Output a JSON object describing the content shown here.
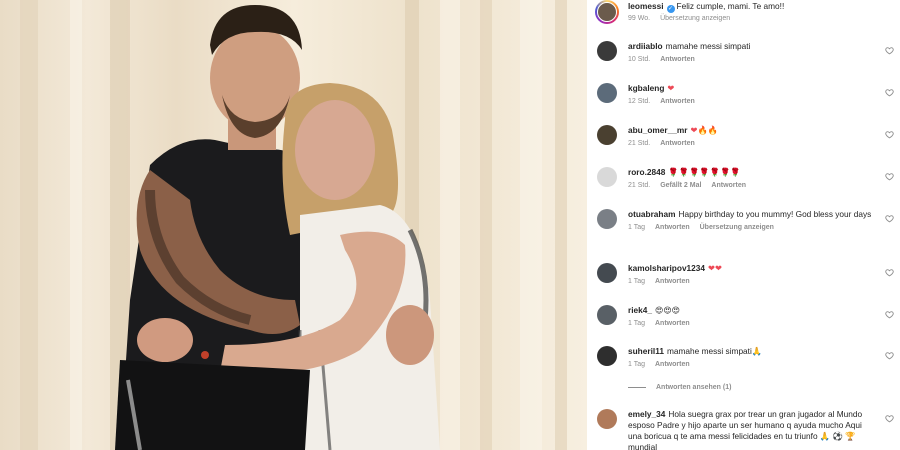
{
  "photo": {
    "alt_subject": ""
  },
  "caption": {
    "username": "leomessi",
    "verified": true,
    "text": "Feliz cumple, mami. Te amo!!",
    "time": "99 Wo.",
    "translate": "Übersetzung anzeigen"
  },
  "comments": [
    {
      "username": "ardiiablo",
      "text": "mamahe messi simpati",
      "time": "10 Std.",
      "reply": "Antworten",
      "avatar_color": "#3a3a3a"
    },
    {
      "username": "kgbaleng",
      "text": "❤",
      "time": "12 Std.",
      "reply": "Antworten",
      "avatar_color": "#5c6b7a"
    },
    {
      "username": "abu_omer__mr",
      "text": "❤🔥🔥",
      "time": "21 Std.",
      "reply": "Antworten",
      "avatar_color": "#4a4030"
    },
    {
      "username": "roro.2848",
      "text": "🌹🌹🌹🌹🌹🌹🌹",
      "time": "21 Std.",
      "likes": "Gefällt 2 Mal",
      "reply": "Antworten",
      "avatar_color": "#d9d9d9"
    },
    {
      "username": "otuabraham",
      "text": "Happy birthday to you mummy! God bless your days",
      "time": "1 Tag",
      "reply": "Antworten",
      "translate": "Übersetzung anzeigen",
      "avatar_color": "#7a7f86"
    },
    {
      "username": "kamolsharipov1234",
      "text": "❤❤",
      "time": "1 Tag",
      "reply": "Antworten",
      "avatar_color": "#444a50"
    },
    {
      "username": "riek4_",
      "text": "😍😍😍",
      "time": "1 Tag",
      "reply": "Antworten",
      "avatar_color": "#596066"
    },
    {
      "username": "suheril11",
      "text": "mamahe messi simpati🙏",
      "time": "1 Tag",
      "reply": "Antworten",
      "avatar_color": "#2e2e2e"
    },
    {
      "username": "emely_34",
      "text": "Hola suegra grax por trear un gran jugador al Mundo esposo Padre y hijo aparte un ser humano q ayuda mucho Aqui una boricua q te ama messi felicidades en tu triunfo 🙏 ⚽ 🏆 mundial",
      "avatar_color": "#b07a5a"
    }
  ],
  "view_replies": "Antworten ansehen (1)",
  "icons": {
    "like": "heart-outline-icon",
    "verified": "verified-badge-icon"
  }
}
